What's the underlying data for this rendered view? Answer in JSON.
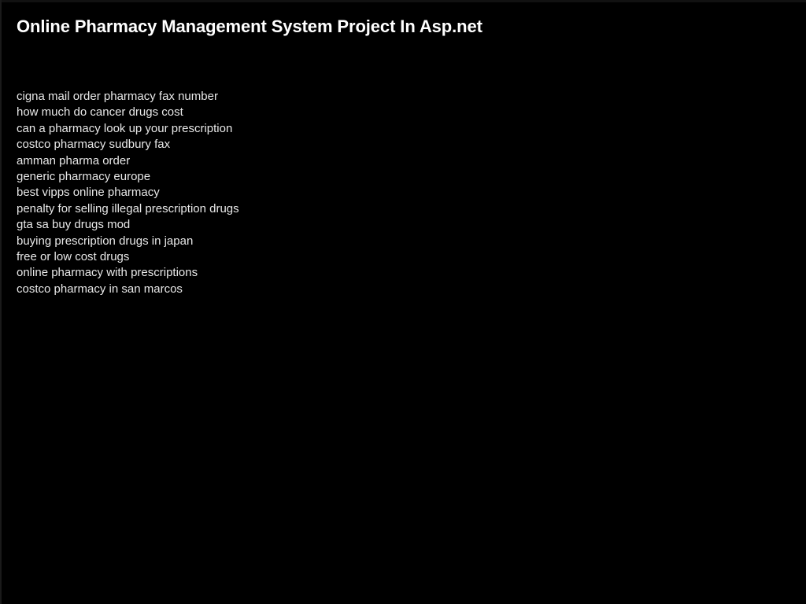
{
  "slide": {
    "background_color": "#000000",
    "title": "Online Pharmacy Management System Project In Asp.net",
    "title_color": "#ffffff",
    "body_color": "#e8e8e8",
    "keywords": [
      "cigna mail order pharmacy fax number",
      "how much do cancer drugs cost",
      "can a pharmacy look up your prescription",
      "costco pharmacy sudbury fax",
      "amman pharma order",
      "generic pharmacy europe",
      "best vipps online pharmacy",
      "penalty for selling illegal prescription drugs",
      "gta sa buy drugs mod",
      "buying prescription drugs in japan",
      "free or low cost drugs",
      "online pharmacy with prescriptions",
      "costco pharmacy in san marcos"
    ]
  }
}
